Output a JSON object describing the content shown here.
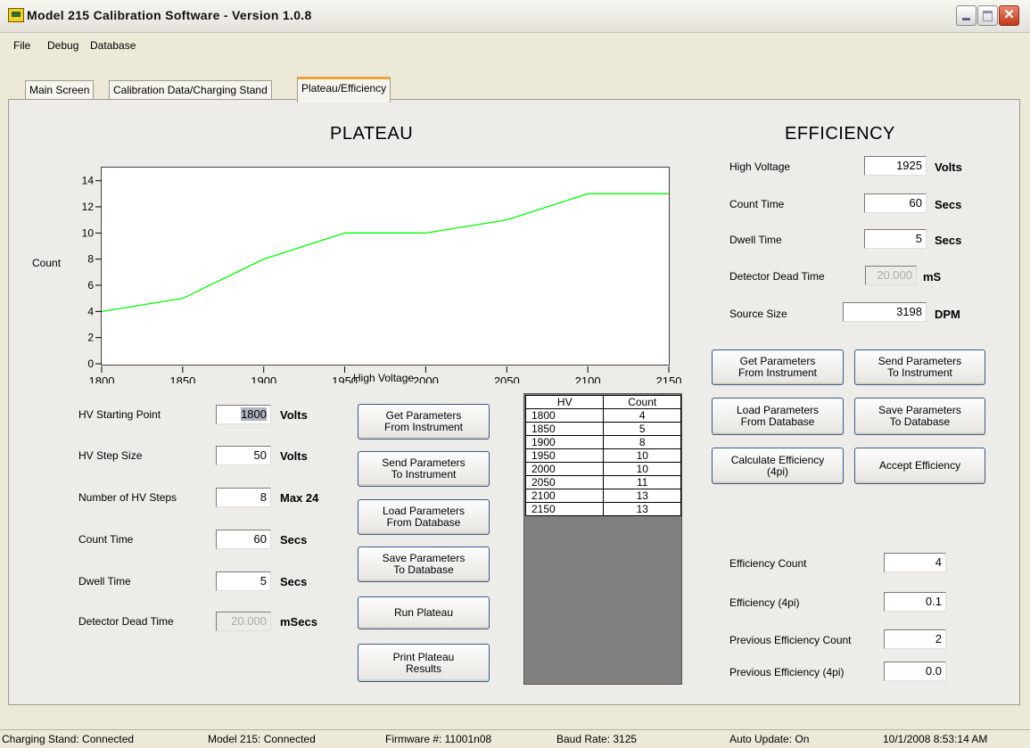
{
  "window": {
    "title": "Model 215 Calibration Software - Version 1.0.8"
  },
  "menu": {
    "items": [
      "File",
      "Debug",
      "Database"
    ]
  },
  "tabs": [
    {
      "label": "Main Screen"
    },
    {
      "label": "Calibration Data/Charging Stand"
    },
    {
      "label": "Plateau/Efficiency",
      "active": true
    }
  ],
  "plateau": {
    "heading": "PLATEAU",
    "chart_data": {
      "type": "line",
      "x": [
        1800,
        1850,
        1900,
        1950,
        2000,
        2050,
        2100,
        2150
      ],
      "series": [
        {
          "values": [
            4,
            5,
            8,
            10,
            10,
            11,
            13,
            13
          ],
          "color": "#00ff00"
        }
      ],
      "xlabel": "High Voltage",
      "ylabel": "Count",
      "xlim": [
        1800,
        2150
      ],
      "ylim": [
        0,
        15
      ],
      "xticks": [
        "1800",
        "1850",
        "1900",
        "1950",
        "2000",
        "2050",
        "2100",
        "2150"
      ],
      "yticks": [
        "0",
        "2",
        "4",
        "6",
        "8",
        "10",
        "12",
        "14"
      ],
      "grid": false
    },
    "fields": {
      "hv_start": {
        "label": "HV Starting Point",
        "value": "1800",
        "unit": "Volts"
      },
      "hv_step": {
        "label": "HV Step Size",
        "value": "50",
        "unit": "Volts"
      },
      "num_steps": {
        "label": "Number of HV Steps",
        "value": "8",
        "unit": "Max 24"
      },
      "count_time": {
        "label": "Count Time",
        "value": "60",
        "unit": "Secs"
      },
      "dwell_time": {
        "label": "Dwell Time",
        "value": "5",
        "unit": "Secs"
      },
      "dead_time": {
        "label": "Detector Dead Time",
        "value": "20.000",
        "unit": "mSecs"
      }
    },
    "buttons": {
      "get_params": "Get Parameters\nFrom Instrument",
      "send_params": "Send Parameters\nTo Instrument",
      "load_params": "Load Parameters\nFrom Database",
      "save_params": "Save Parameters\nTo Database",
      "run": "Run Plateau",
      "print": "Print Plateau\nResults"
    },
    "table": {
      "headers": [
        "HV",
        "Count"
      ],
      "rows": [
        [
          "1800",
          "4"
        ],
        [
          "1850",
          "5"
        ],
        [
          "1900",
          "8"
        ],
        [
          "1950",
          "10"
        ],
        [
          "2000",
          "10"
        ],
        [
          "2050",
          "11"
        ],
        [
          "2100",
          "13"
        ],
        [
          "2150",
          "13"
        ]
      ]
    }
  },
  "efficiency": {
    "heading": "EFFICIENCY",
    "fields": {
      "high_voltage": {
        "label": "High Voltage",
        "value": "1925",
        "unit": "Volts"
      },
      "count_time": {
        "label": "Count Time",
        "value": "60",
        "unit": "Secs"
      },
      "dwell_time": {
        "label": "Dwell Time",
        "value": "5",
        "unit": "Secs"
      },
      "dead_time": {
        "label": "Detector Dead Time",
        "value": "20.000",
        "unit": "mS"
      },
      "source_size": {
        "label": "Source Size",
        "value": "3198",
        "unit": "DPM"
      }
    },
    "buttons": {
      "get_params": "Get Parameters\nFrom Instrument",
      "send_params": "Send Parameters\nTo Instrument",
      "load_params": "Load Parameters\nFrom Database",
      "save_params": "Save Parameters\nTo Database",
      "calculate": "Calculate Efficiency\n(4pi)",
      "accept": "Accept Efficiency"
    },
    "results": {
      "eff_count": {
        "label": "Efficiency Count",
        "value": "4"
      },
      "eff_4pi": {
        "label": "Efficiency (4pi)",
        "value": "0.1"
      },
      "prev_count": {
        "label": "Previous Efficiency Count",
        "value": "2"
      },
      "prev_4pi": {
        "label": "Previous Efficiency (4pi)",
        "value": "0.0"
      }
    }
  },
  "status": {
    "charging_stand": "Charging Stand: Connected",
    "model": "Model 215: Connected",
    "firmware": "Firmware #:  11001n08",
    "baud": "Baud Rate: 3125",
    "auto_update": "Auto Update: On",
    "datetime": "10/1/2008 8:53:14 AM"
  }
}
